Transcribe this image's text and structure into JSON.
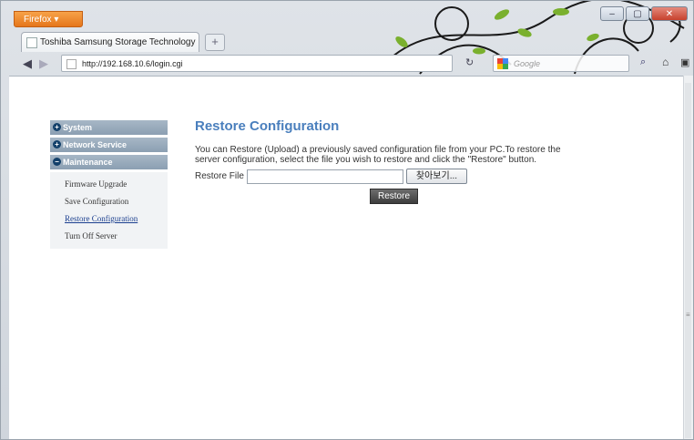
{
  "browser": {
    "menu_label": "Firefox ▾",
    "tab_title": "Toshiba Samsung Storage Technology",
    "new_tab": "+",
    "url": "http://192.168.10.6/login.cgi",
    "search_placeholder": "Google",
    "controls": {
      "minimize": "–",
      "maximize": "▢",
      "close": "✕"
    }
  },
  "sidebar": {
    "sections": [
      {
        "label": "System"
      },
      {
        "label": "Network Service"
      },
      {
        "label": "Maintenance"
      }
    ],
    "items": [
      {
        "label": "Firmware Upgrade"
      },
      {
        "label": "Save Configuration"
      },
      {
        "label": "Restore Configuration"
      },
      {
        "label": "Turn Off Server"
      }
    ]
  },
  "main": {
    "title": "Restore Configuration",
    "description": "You can Restore (Upload) a previously saved configuration file from your PC.To restore the server configuration, select the file you wish to restore and click the \"Restore\" button.",
    "file_label": "Restore File",
    "browse_label": "찾아보기...",
    "restore_label": "Restore"
  }
}
